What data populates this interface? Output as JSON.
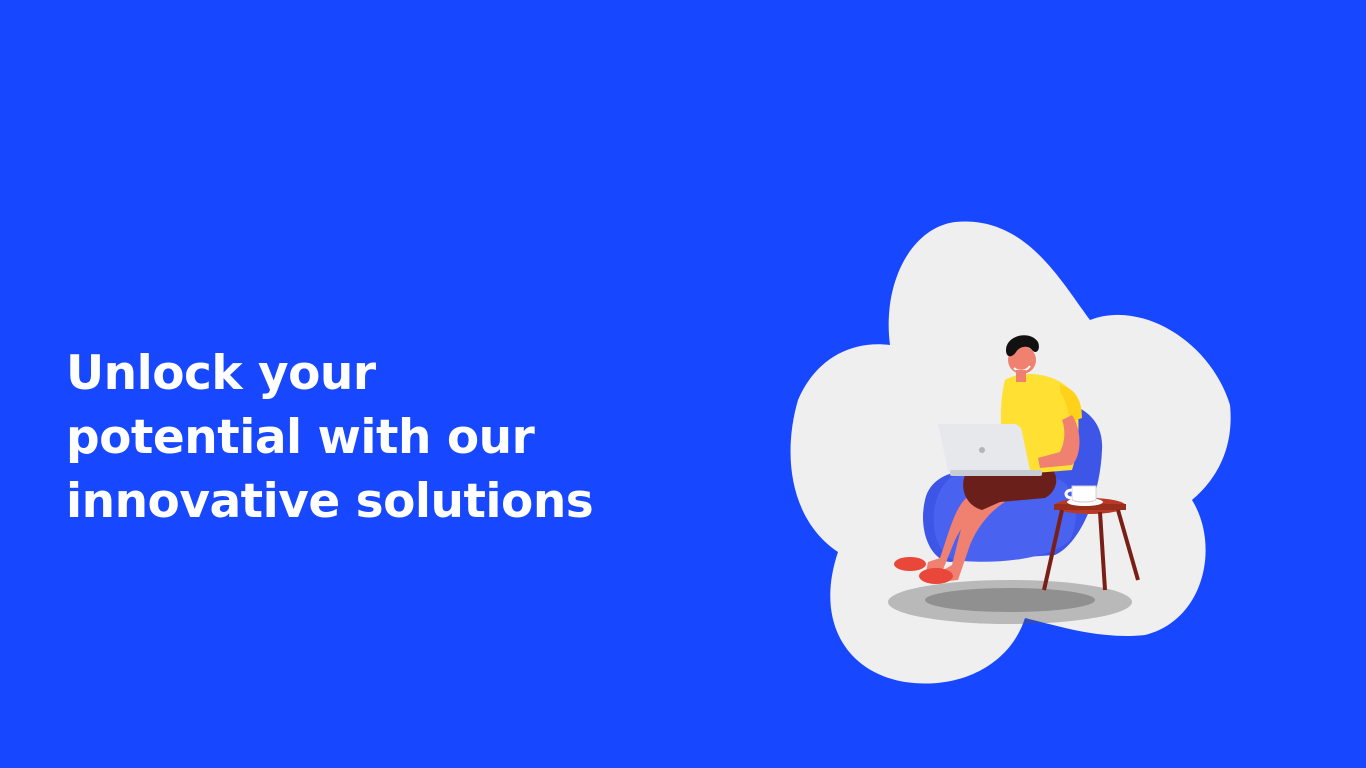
{
  "hero": {
    "headline_lines": [
      "Unlock your",
      "potential with our",
      "innovative solutions"
    ]
  },
  "illustration": {
    "subject": "person-working-on-laptop",
    "icons": [
      "cloud-blob-shape",
      "person-figure",
      "laptop-icon",
      "armchair-icon",
      "side-table-icon",
      "coffee-cup-icon",
      "floor-shadow"
    ]
  },
  "colors": {
    "background": "#1747FF",
    "headline_text": "#FFFFFF",
    "blob": "#EFEFEF",
    "shirt": "#FFE033",
    "chair": "#3E56E8",
    "table": "#B83A26",
    "skin": "#F08070",
    "shorts": "#6B1F1A",
    "hair": "#111111",
    "laptop": "#E6E8EC"
  }
}
